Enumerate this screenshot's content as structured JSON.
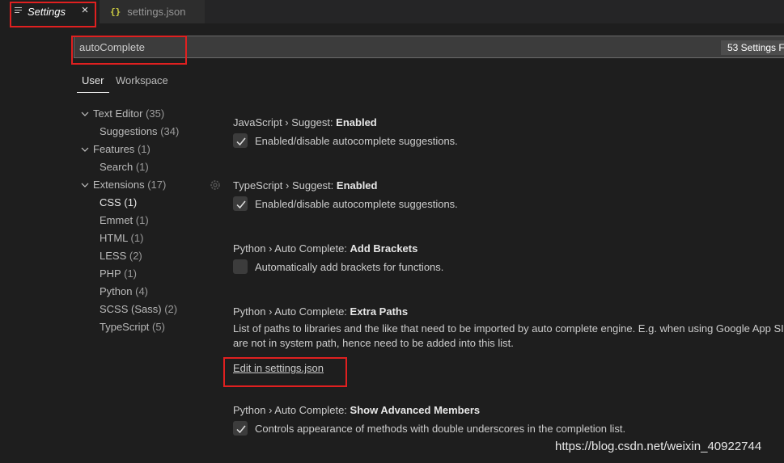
{
  "tabs": [
    {
      "label": "Settings",
      "icon": "menu-icon",
      "active": true
    },
    {
      "label": "settings.json",
      "icon": "json-braces-icon",
      "active": false
    }
  ],
  "tab_close_glyph": "×",
  "search": {
    "value": "autoComplete",
    "results_badge": "53 Settings F"
  },
  "scope_tabs": [
    "User",
    "Workspace"
  ],
  "toc": [
    {
      "label": "Text Editor",
      "count": "(35)",
      "expanded": true
    },
    {
      "label": "Suggestions",
      "count": "(34)"
    },
    {
      "label": "Features",
      "count": "(1)",
      "expanded": true
    },
    {
      "label": "Search",
      "count": "(1)"
    },
    {
      "label": "Extensions",
      "count": "(17)",
      "expanded": true
    },
    {
      "label": "CSS",
      "count": "(1)",
      "selected": true
    },
    {
      "label": "Emmet",
      "count": "(1)"
    },
    {
      "label": "HTML",
      "count": "(1)"
    },
    {
      "label": "LESS",
      "count": "(2)"
    },
    {
      "label": "PHP",
      "count": "(1)"
    },
    {
      "label": "Python",
      "count": "(4)"
    },
    {
      "label": "SCSS (Sass)",
      "count": "(2)"
    },
    {
      "label": "TypeScript",
      "count": "(5)"
    }
  ],
  "settings": [
    {
      "category": "JavaScript › Suggest: ",
      "name": "Enabled",
      "description": "Enabled/disable autocomplete suggestions.",
      "checked": true
    },
    {
      "category": "TypeScript › Suggest: ",
      "name": "Enabled",
      "description": "Enabled/disable autocomplete suggestions.",
      "checked": true
    },
    {
      "category": "Python › Auto Complete: ",
      "name": "Add Brackets",
      "description": "Automatically add brackets for functions.",
      "checked": false
    },
    {
      "category": "Python › Auto Complete: ",
      "name": "Extra Paths",
      "description_line1": "List of paths to libraries and the like that need to be imported by auto complete engine. E.g. when using Google App SI",
      "description_line2": "are not in system path, hence need to be added into this list.",
      "link": "Edit in settings.json"
    },
    {
      "category": "Python › Auto Complete: ",
      "name": "Show Advanced Members",
      "description": "Controls appearance of methods with double underscores in the completion list.",
      "checked": true
    }
  ],
  "watermark": "https://blog.csdn.net/weixin_40922744",
  "colors": {
    "background": "#1e1e1e",
    "annotation": "#e02020",
    "json_icon": "#cbcb41"
  }
}
